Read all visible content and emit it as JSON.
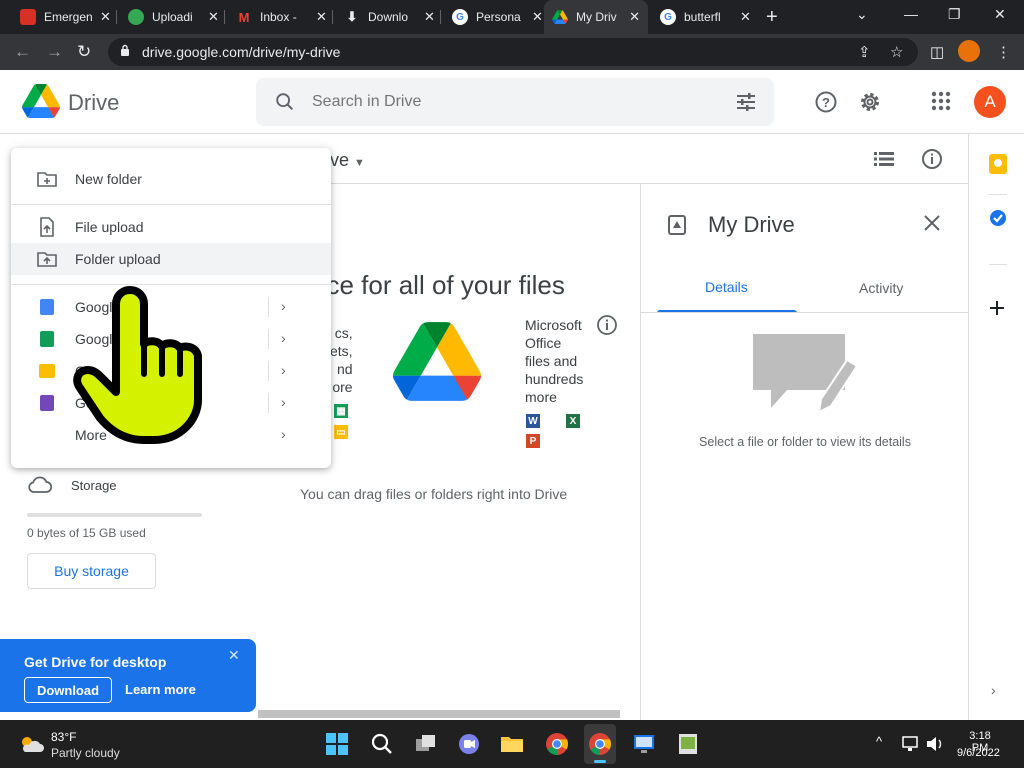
{
  "browser": {
    "tabs": [
      {
        "title": "Emergen",
        "fav_color": "#d93025"
      },
      {
        "title": "Uploadi",
        "fav_color": "#34a853"
      },
      {
        "title": "Inbox -",
        "fav_color": "#ea4335"
      },
      {
        "title": "Downlo",
        "fav_color": "#e8eaed"
      },
      {
        "title": "Persona",
        "fav_color": "#4285f4"
      },
      {
        "title": "My Driv",
        "fav_color": "#fbbc04"
      },
      {
        "title": "butterfl",
        "fav_color": "#4285f4"
      }
    ],
    "url": "drive.google.com/drive/my-drive"
  },
  "drive": {
    "logo_text": "Drive",
    "search_placeholder": "Search in Drive",
    "avatar_initial": "A"
  },
  "new_menu": {
    "items": [
      {
        "label": "New folder"
      },
      {
        "label": "File upload"
      },
      {
        "label": "Folder upload"
      },
      {
        "label": "Google"
      },
      {
        "label": "Google"
      },
      {
        "label": "G"
      },
      {
        "label": "Goog"
      },
      {
        "label": "More"
      }
    ]
  },
  "sidebar": {
    "storage_label": "Storage",
    "storage_used": "0 bytes of 15 GB used",
    "storage_fraction": 0.0,
    "buy_storage": "Buy storage"
  },
  "main": {
    "breadcrumb_fragment": "ve",
    "title": "ace for all of your files",
    "left_fragment_lines": [
      "cs,",
      "ets,",
      "nd",
      "ore"
    ],
    "ms_lines": [
      "Microsoft",
      "Office",
      "files and",
      "hundreds",
      "more"
    ],
    "ms_badges": [
      "W",
      "X",
      "P"
    ],
    "drop_hint": "You can drag files or folders right into Drive"
  },
  "details": {
    "title": "My Drive",
    "tab_details": "Details",
    "tab_activity": "Activity",
    "empty_text": "Select a file or folder to view its details"
  },
  "promo": {
    "title": "Get Drive for desktop",
    "download": "Download",
    "learn_more": "Learn more"
  },
  "taskbar": {
    "temp": "83°F",
    "weather": "Partly cloudy",
    "time": "3:18 PM",
    "date": "9/6/2022"
  },
  "colors": {
    "accent": "#1a73e8",
    "hand": "#d4f200"
  }
}
